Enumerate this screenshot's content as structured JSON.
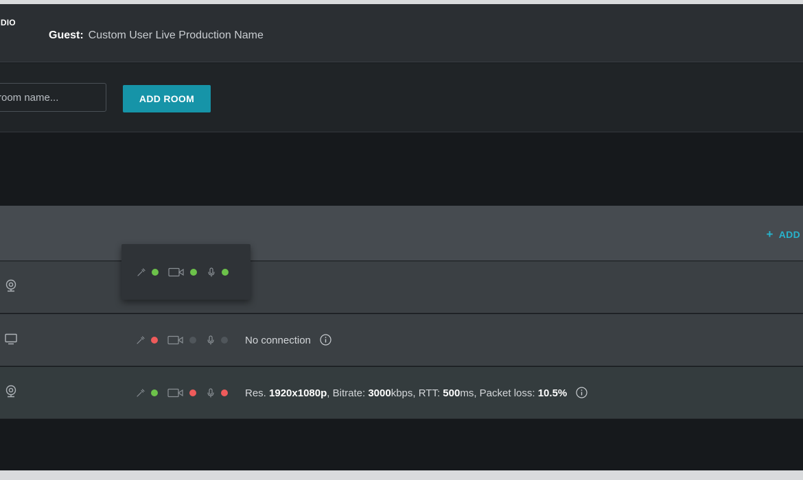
{
  "app": {
    "logo_text": "UDIO"
  },
  "header": {
    "guest_label": "Guest:",
    "production_name": "Custom User Live Production Name"
  },
  "add_room": {
    "placeholder": "room name...",
    "button_label": "ADD ROOM"
  },
  "room": {
    "add_label": "ADD",
    "add_icon": "+"
  },
  "popover": {
    "indicators": {
      "connection": "green",
      "camera": "green",
      "microphone": "green"
    }
  },
  "devices": [
    {
      "device_icon": "webcam-icon",
      "indicators": {
        "connection": "green",
        "camera": "green",
        "microphone": "green"
      },
      "status": null
    },
    {
      "device_icon": "monitor-icon",
      "indicators": {
        "connection": "red",
        "camera": "gray",
        "microphone": "gray"
      },
      "status": {
        "text": "No connection"
      }
    },
    {
      "device_icon": "webcam-icon",
      "indicators": {
        "connection": "green",
        "camera": "red",
        "microphone": "red"
      },
      "status": {
        "res_label": "Res.",
        "res_value": "1920x1080p",
        "bitrate_label": "Bitrate:",
        "bitrate_value": "3000",
        "bitrate_unit": "kbps",
        "rtt_label": "RTT:",
        "rtt_value": "500",
        "rtt_unit": "ms",
        "loss_label": "Packet loss:",
        "loss_value": "10.5%"
      }
    }
  ],
  "colors": {
    "accent": "#1694a8",
    "link": "#27b3cc",
    "ok": "#6cc24a",
    "error": "#ef5b5b",
    "inactive": "#50565b"
  }
}
